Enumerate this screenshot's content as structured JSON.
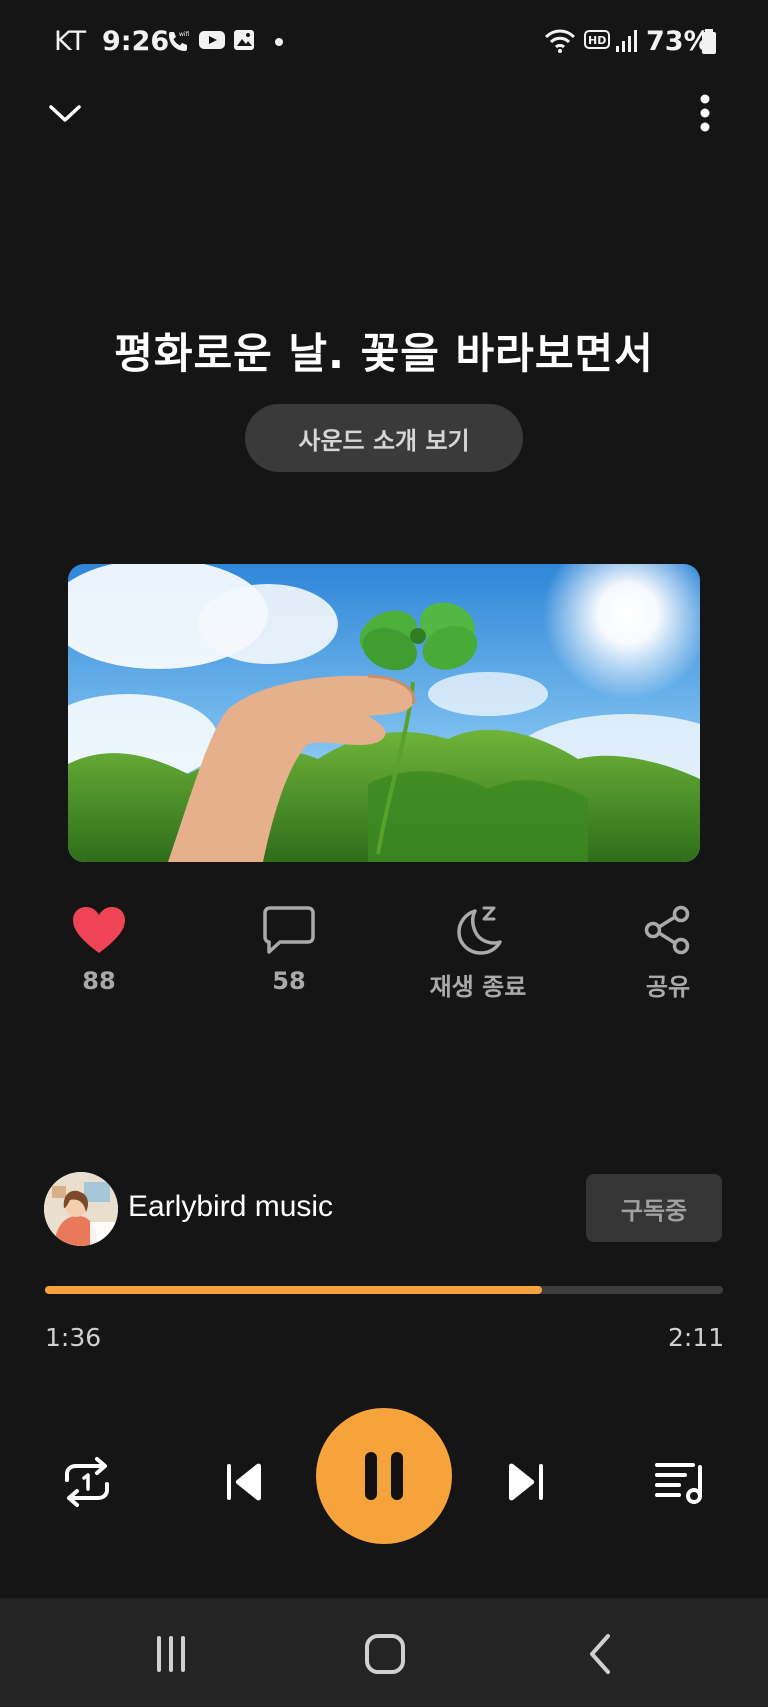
{
  "status_bar": {
    "carrier": "KT",
    "time": "9:26",
    "battery": "73%",
    "icons": [
      "wifi-calling-icon",
      "youtube-icon",
      "gallery-icon",
      "dot-icon",
      "wifi-icon",
      "hd-icon",
      "signal-icon",
      "battery-icon"
    ]
  },
  "header": {
    "collapse_icon": "chevron-down-icon",
    "more_icon": "more-vertical-icon"
  },
  "track": {
    "title": "평화로운 날. 꽃을 바라보면서",
    "intro_button": "사운드 소개 보기"
  },
  "actions": {
    "like": {
      "icon": "heart-icon",
      "label": "88"
    },
    "comment": {
      "icon": "chat-bubble-icon",
      "label": "58"
    },
    "sleep": {
      "icon": "moon-sleep-icon",
      "label": "재생 종료"
    },
    "share": {
      "icon": "share-icon",
      "label": "공유"
    }
  },
  "channel": {
    "name": "Earlybird music",
    "subscribe_label": "구독중"
  },
  "player": {
    "elapsed": "1:36",
    "total": "2:11",
    "progress": 0.733
  },
  "colors": {
    "accent": "#f7a33b",
    "background": "#151515",
    "like": "#ee4455"
  }
}
